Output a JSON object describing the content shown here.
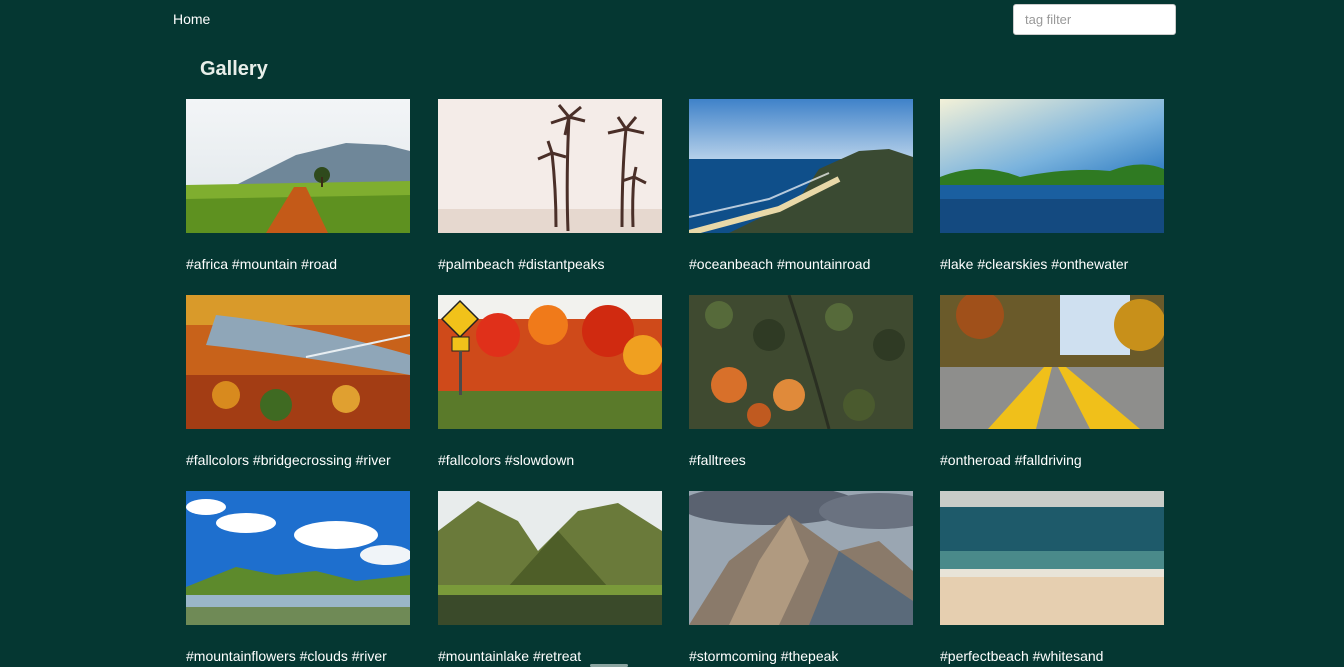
{
  "nav": {
    "home_label": "Home"
  },
  "filter": {
    "placeholder": "tag filter",
    "value": ""
  },
  "gallery": {
    "title": "Gallery",
    "items": [
      {
        "caption": "#africa #mountain #road",
        "scene": "africa-road"
      },
      {
        "caption": "#palmbeach #distantpeaks",
        "scene": "palm-beach"
      },
      {
        "caption": "#oceanbeach #mountainroad",
        "scene": "ocean-beach"
      },
      {
        "caption": "#lake #clearskies #onthewater",
        "scene": "lake"
      },
      {
        "caption": "#fallcolors #bridgecrossing #river",
        "scene": "fall-bridge"
      },
      {
        "caption": "#fallcolors #slowdown",
        "scene": "fall-sign"
      },
      {
        "caption": "#falltrees",
        "scene": "fall-trees"
      },
      {
        "caption": "#ontheroad #falldriving",
        "scene": "fall-road"
      },
      {
        "caption": "#mountainflowers #clouds #river",
        "scene": "mountain-clouds"
      },
      {
        "caption": "#mountainlake #retreat",
        "scene": "mountain-lake"
      },
      {
        "caption": "#stormcoming #thepeak",
        "scene": "storm-peak"
      },
      {
        "caption": "#perfectbeach #whitesand",
        "scene": "white-sand"
      }
    ]
  },
  "colors": {
    "background": "#053732",
    "text": "#ffffff"
  }
}
